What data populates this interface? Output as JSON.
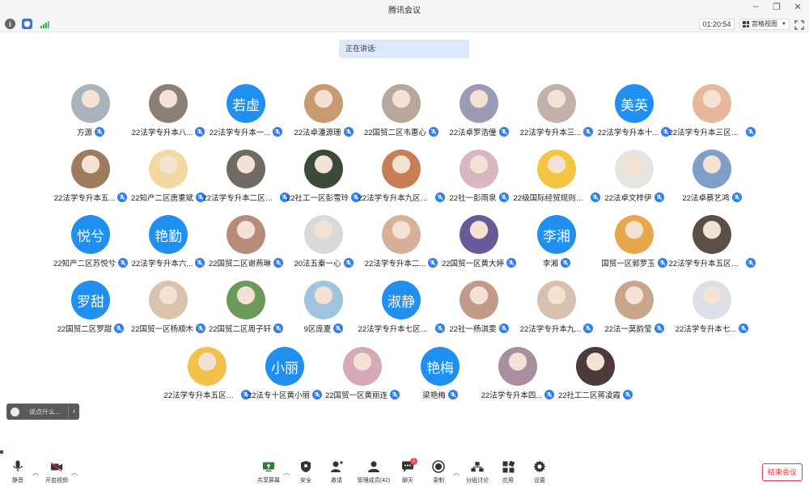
{
  "window": {
    "title": "腾讯会议"
  },
  "status": {
    "timer": "01:20:54",
    "view_mode": "宫格视图"
  },
  "speaking": {
    "label": "正在讲话:"
  },
  "chat_input": {
    "placeholder": "说点什么..."
  },
  "participants": [
    {
      "name": "方源",
      "avatar": "photo",
      "color": "#a9b3bd"
    },
    {
      "name": "22法学专升本八...",
      "avatar": "photo",
      "color": "#8c7f78"
    },
    {
      "name": "22法学专升本一...",
      "avatar": "text",
      "text": "若虚"
    },
    {
      "name": "22法卓潘源珊",
      "avatar": "photo",
      "color": "#c89a72"
    },
    {
      "name": "22国贸二区韦惠心",
      "avatar": "photo",
      "color": "#b9a79a"
    },
    {
      "name": "22法卓罗浩僮",
      "avatar": "photo",
      "color": "#9c9bb5"
    },
    {
      "name": "22法学专升本三...",
      "avatar": "photo",
      "color": "#c2b0aa"
    },
    {
      "name": "22法学专升本十...",
      "avatar": "text",
      "text": "美英"
    },
    {
      "name": "22法学专升本三区韦...",
      "avatar": "photo",
      "color": "#e6b79a"
    },
    {
      "name": "22法学专升本五...",
      "avatar": "photo",
      "color": "#9e7b5c"
    },
    {
      "name": "22知产二区唐重斌",
      "avatar": "photo",
      "color": "#f2d9a2"
    },
    {
      "name": "22法学专升本二区曾...",
      "avatar": "photo",
      "color": "#6f6a63"
    },
    {
      "name": "22社工一区彭雪玲",
      "avatar": "photo",
      "color": "#3c4a3a"
    },
    {
      "name": "22法学专升本九区张旋",
      "avatar": "photo",
      "color": "#c97d55"
    },
    {
      "name": "22社一彭雨泉",
      "avatar": "photo",
      "color": "#d8b6c2"
    },
    {
      "name": "22级国际经贸规则二...",
      "avatar": "photo",
      "color": "#f5c542"
    },
    {
      "name": "22法卓文梓伊",
      "avatar": "photo",
      "color": "#e8e4df"
    },
    {
      "name": "22法卓蔡艺鸿",
      "avatar": "photo",
      "color": "#7f9fc9"
    },
    {
      "name": "22知产二区苏悦兮",
      "avatar": "text",
      "text": "悦兮"
    },
    {
      "name": "22法学专升本六...",
      "avatar": "text",
      "text": "艳勤"
    },
    {
      "name": "22国贸二区谢燕琳",
      "avatar": "photo",
      "color": "#b78a7a"
    },
    {
      "name": "20法五秦一心",
      "avatar": "photo",
      "color": "#d9d9d9"
    },
    {
      "name": "22法学专升本二...",
      "avatar": "photo",
      "color": "#d6b09a"
    },
    {
      "name": "22国贸一区黄大婷",
      "avatar": "photo",
      "color": "#6a5a9a"
    },
    {
      "name": "李湘",
      "avatar": "text",
      "text": "李湘"
    },
    {
      "name": "国贸一区郭罗玉",
      "avatar": "photo",
      "color": "#e8a74a"
    },
    {
      "name": "22法学专升本五区覃...",
      "avatar": "photo",
      "color": "#5c4f4a"
    },
    {
      "name": "22国贸二区罗甜",
      "avatar": "text",
      "text": "罗甜"
    },
    {
      "name": "22国贸一区杨顺木",
      "avatar": "photo",
      "color": "#d9c3ad"
    },
    {
      "name": "22国贸二区周子轩",
      "avatar": "photo",
      "color": "#6b9a5a"
    },
    {
      "name": "9区庞夏",
      "avatar": "photo",
      "color": "#9ec4de"
    },
    {
      "name": "22法学专升本七区马...",
      "avatar": "text",
      "text": "淑静"
    },
    {
      "name": "22社一杨淇雯",
      "avatar": "photo",
      "color": "#c29a8a"
    },
    {
      "name": "22法学专升本九...",
      "avatar": "photo",
      "color": "#d8c0b0"
    },
    {
      "name": "22法一莫韵莹",
      "avatar": "photo",
      "color": "#c8a68a"
    },
    {
      "name": "22法学专升本七...",
      "avatar": "photo",
      "color": "#dcdfe3"
    },
    {
      "name": "22法学专升本五区陆...",
      "avatar": "photo",
      "color": "#f2c14a"
    },
    {
      "name": "22法专十区黄小丽",
      "avatar": "text",
      "text": "小丽"
    },
    {
      "name": "22国贸一区黄丽连",
      "avatar": "photo",
      "color": "#d7a8b8"
    },
    {
      "name": "梁艳梅",
      "avatar": "text",
      "text": "艳梅"
    },
    {
      "name": "22法学专升本四...",
      "avatar": "photo",
      "color": "#a88fa0"
    },
    {
      "name": "22社工二区蒋凌霞",
      "avatar": "photo",
      "color": "#4a3a3a"
    }
  ],
  "toolbar": {
    "mute": "静音",
    "video": "开启视频",
    "share": "共享屏幕",
    "security": "安全",
    "invite": "邀请",
    "members": "管理成员(42)",
    "chat": "聊天",
    "chat_badge": "1",
    "record": "录制",
    "breakout": "分组讨论",
    "apps": "应用",
    "settings": "设置",
    "end": "结束会议"
  }
}
